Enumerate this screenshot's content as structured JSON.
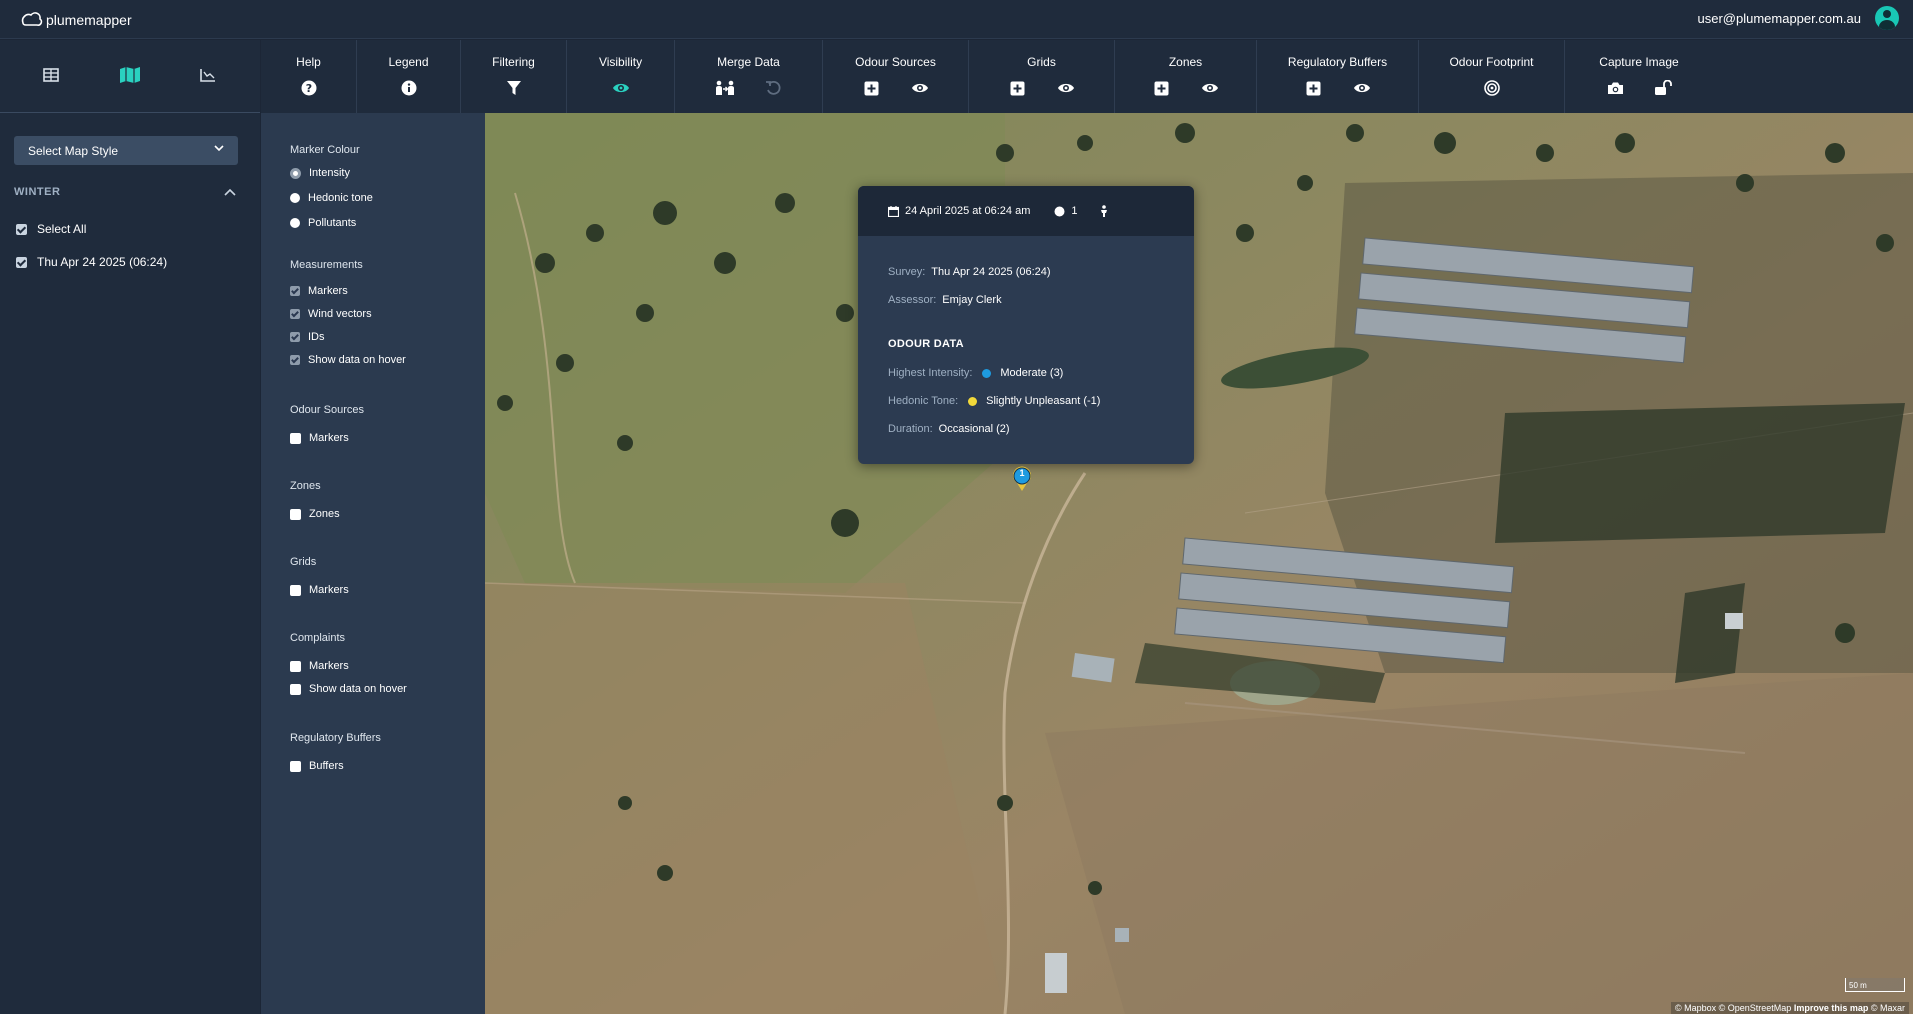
{
  "app": {
    "logo_text": "plumemapper",
    "user_email": "user@plumemapper.com.au"
  },
  "sidebar": {
    "map_style_label": "Select Map Style",
    "season_label": "WINTER",
    "select_all_label": "Select All",
    "survey_label": "Thu Apr 24 2025 (06:24)"
  },
  "toolbar": {
    "help": "Help",
    "legend": "Legend",
    "filtering": "Filtering",
    "visibility": "Visibility",
    "merge_data": "Merge Data",
    "odour_sources": "Odour Sources",
    "grids": "Grids",
    "zones": "Zones",
    "regulatory_buffers": "Regulatory Buffers",
    "odour_footprint": "Odour Footprint",
    "capture_image": "Capture Image"
  },
  "panel": {
    "marker_colour": "Marker Colour",
    "intensity": "Intensity",
    "hedonic_tone": "Hedonic tone",
    "pollutants": "Pollutants",
    "measurements": "Measurements",
    "markers": "Markers",
    "wind_vectors": "Wind vectors",
    "ids": "IDs",
    "show_data_on_hover": "Show data on hover",
    "odour_sources": "Odour Sources",
    "zones": "Zones",
    "zones_item": "Zones",
    "grids": "Grids",
    "complaints": "Complaints",
    "regulatory_buffers": "Regulatory Buffers",
    "buffers": "Buffers"
  },
  "popup": {
    "datetime": "24 April 2025 at 06:24 am",
    "count": "1",
    "survey_label": "Survey:",
    "survey_value": "Thu Apr 24 2025 (06:24)",
    "assessor_label": "Assessor:",
    "assessor_value": "Emjay Clerk",
    "section_title": "ODOUR DATA",
    "intensity_label": "Highest Intensity:",
    "intensity_value": "Moderate (3)",
    "intensity_color": "#1e9be0",
    "hedonic_label": "Hedonic Tone:",
    "hedonic_value": "Slightly Unpleasant (-1)",
    "hedonic_color": "#f2d93a",
    "duration_label": "Duration:",
    "duration_value": "Occasional (2)"
  },
  "marker": {
    "id": "1"
  },
  "map": {
    "scale_label": "50 m",
    "attribution_prefix": "© Mapbox © OpenStreetMap",
    "attribution_link": "Improve this map",
    "attribution_suffix": "© Maxar"
  },
  "colors": {
    "accent": "#19c7b5",
    "header_bg": "#1f2b3c",
    "panel_bg": "#2b3a4f"
  }
}
